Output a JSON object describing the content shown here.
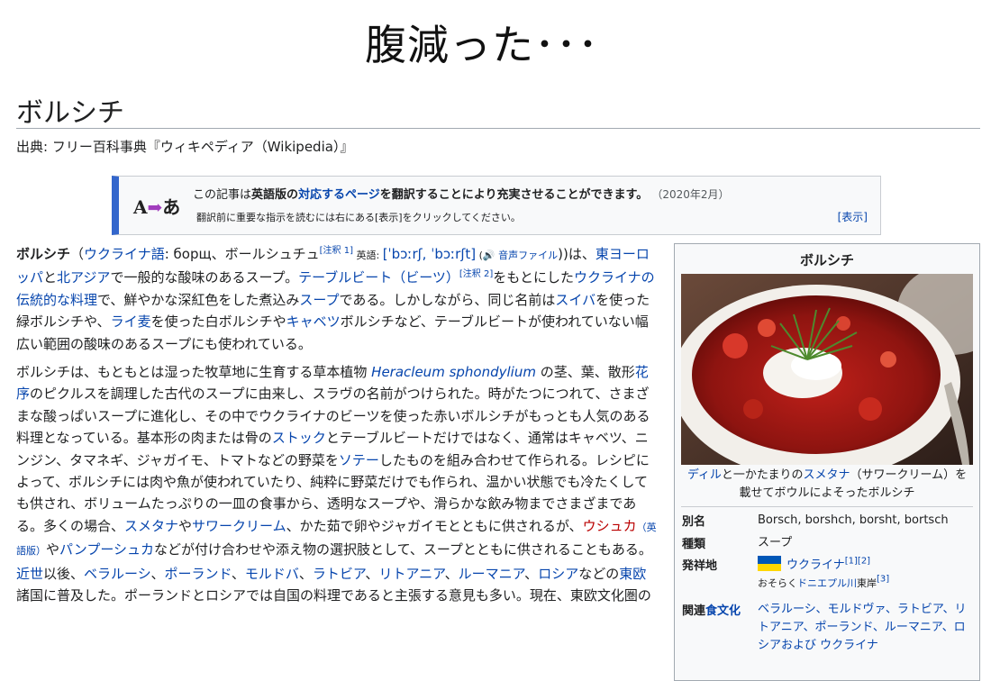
{
  "slide": {
    "title": "腹減った･･･"
  },
  "article": {
    "title": "ボルシチ",
    "source": "出典: フリー百科事典『ウィキペディア（Wikipedia）』"
  },
  "notice": {
    "icon_a": "A",
    "icon_arrow": "➡",
    "icon_b": "あ",
    "t1": "この記事は",
    "t2": "英語版の",
    "t3": "対応するページ",
    "t4": "を翻訳することにより充実させることができます。",
    "date": "（2020年2月）",
    "sub": "翻訳前に重要な指示を読むには右にある[表示]をクリックしてください。",
    "show": "[表示]"
  },
  "para1": {
    "s1": "ボルシチ",
    "s2": "（",
    "s3": "ウクライナ語",
    "s4": ": борщ、ボールシュチュ",
    "s5": "[注釈 1]",
    "s6": " 英語: ",
    "s7": "[ˈbɔːrʃ, ˈbɔːrʃt]",
    "s8": " (",
    "s9": "🔊",
    "s10": " 音声ファイル",
    "s11": "))は、",
    "s12": "東ヨーロッパ",
    "s13": "と",
    "s14": "北アジア",
    "s15": "で一般的な酸味のあるスープ。",
    "s16": "テーブルビート（ビーツ）",
    "s17": "[注釈 2]",
    "s18": "をもとにした",
    "s19": "ウクライナの伝統的な料理",
    "s20": "で、鮮やかな深紅色をした煮込み",
    "s21": "スープ",
    "s22": "である。しかしながら、同じ名前は",
    "s23": "スイバ",
    "s24": "を使った緑ボルシチや、",
    "s25": "ライ麦",
    "s26": "を使った白ボルシチや",
    "s27": "キャベツ",
    "s28": "ボルシチなど、テーブルビートが使われていない幅広い範囲の酸味のあるスープにも使われている。"
  },
  "para2": {
    "s1": "ボルシチは、もともとは湿った牧草地に生育する草本植物 ",
    "s2": "Heracleum sphondylium",
    "s3": " の茎、葉、散形",
    "s4": "花序",
    "s5": "のピクルスを調理した古代のスープに由来し、スラヴの名前がつけられた。時がたつにつれて、さまざまな酸っぱいスープに進化し、その中でウクライナのビーツを使った赤いボルシチがもっとも人気のある料理となっている。基本形の肉または骨の",
    "s6": "ストック",
    "s7": "とテーブルビートだけではなく、通常はキャベツ、ニンジン、タマネギ、ジャガイモ、トマトなどの野菜を",
    "s8": "ソテー",
    "s9": "したものを組み合わせて作られる。レシピによって、ボルシチには肉や魚が使われていたり、純粋に野菜だけでも作られ、温かい状態でも冷たくしても供され、ボリュームたっぷりの一皿の食事から、透明なスープや、滑らかな飲み物までさまざまである。多くの場合、",
    "s10": "スメタナ",
    "s11": "や",
    "s12": "サワークリーム",
    "s13": "、かた茹で卵やジャガイモとともに供されるが、",
    "s14": "ウシュカ",
    "s15": "（英語版）",
    "s16": "や",
    "s17": "パンプーシュカ",
    "s18": "などが付け合わせや添え物の選択肢として、スープとともに供されることもある。 ",
    "s19": "近世",
    "s20": "以後、",
    "s21": "ベラルーシ",
    "s22": "、",
    "s23": "ポーランド",
    "s24": "、",
    "s25": "モルドバ",
    "s26": "、",
    "s27": "ラトビア",
    "s28": "、",
    "s29": "リトアニア",
    "s30": "、",
    "s31": "ルーマニア",
    "s32": "、",
    "s33": "ロシア",
    "s34": "などの",
    "s35": "東欧",
    "s36": "諸国に普及した。ポーランドとロシアでは自国の料理であると主張する意見も多い。現在、東欧文化圏の"
  },
  "infobox": {
    "title": "ボルシチ",
    "caption_1": "ディル",
    "caption_2": "と一かたまりの",
    "caption_3": "スメタナ",
    "caption_4": "（サワークリーム）を載せてボウルによそったボルシチ",
    "rows": {
      "alias_k": "別名",
      "alias_v": "Borsch, borshch, borsht, bortsch",
      "kind_k": "種類",
      "kind_v": "スープ",
      "origin_k": "発祥地",
      "origin_v": "ウクライナ",
      "origin_ref": "[1][2]",
      "origin_sub1": "おそらく",
      "origin_sub2": "ドニエプル川",
      "origin_sub3": "東岸",
      "origin_ref2": "[3]",
      "rel_k1": "関連",
      "rel_k2": "食文化",
      "rel_v": "ベラルーシ、モルドヴァ、ラトビア、リトアニア、ポーランド、ルーマニア、ロシアおよび ウクライナ"
    }
  }
}
